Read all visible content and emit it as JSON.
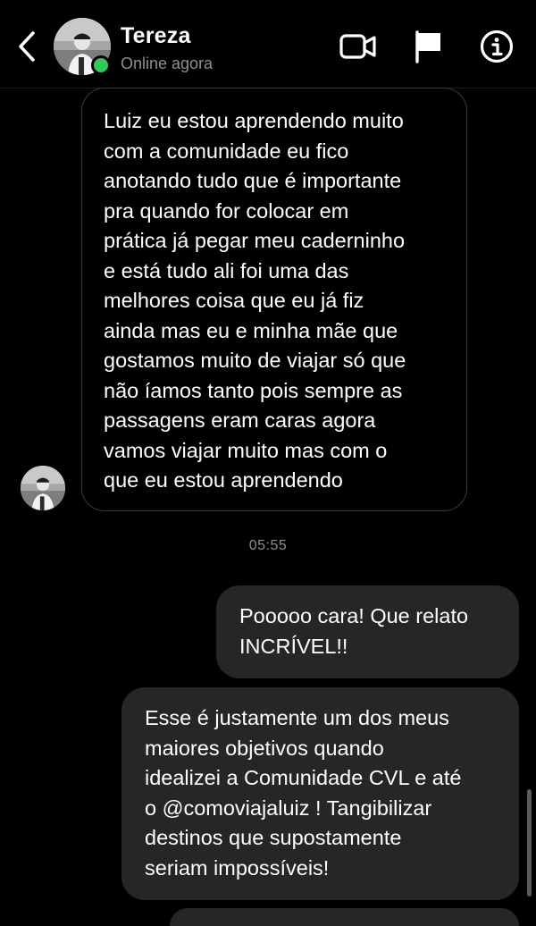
{
  "header": {
    "back_icon": "chevron-left-icon",
    "contact_name": "Tereza",
    "status": "Online agora",
    "online_color": "#35c759",
    "actions": [
      "video-camera-icon",
      "flag-icon",
      "info-icon"
    ]
  },
  "messages": [
    {
      "direction": "incoming",
      "text": "Luiz eu estou aprendendo muito\ncom a comunidade eu fico\nanotando tudo que é importante\npra quando for colocar em\nprática já pegar meu caderninho\ne está tudo ali foi uma das\nmelhores coisa que eu já fiz\nainda mas eu e minha mãe que\ngostamos muito de viajar só que\nnão íamos tanto pois sempre as\npassagens eram caras agora\nvamos viajar muito mas com o\nque eu estou aprendendo"
    },
    {
      "direction": "outgoing",
      "text": "Pooooo cara! Que relato\nINCRÍVEL!!"
    },
    {
      "direction": "outgoing",
      "text": "Esse é justamente um dos meus\nmaiores objetivos quando\nidealizei a Comunidade CVL e até\no @comoviajaluiz ! Tangibilizar\ndestinos que supostamente\nseriam impossíveis!"
    }
  ],
  "timestamp": "05:55",
  "colors": {
    "background": "#000000",
    "outgoing_bubble": "#262628",
    "incoming_border": "#3a3a3c",
    "secondary_text": "#8e8e93"
  }
}
